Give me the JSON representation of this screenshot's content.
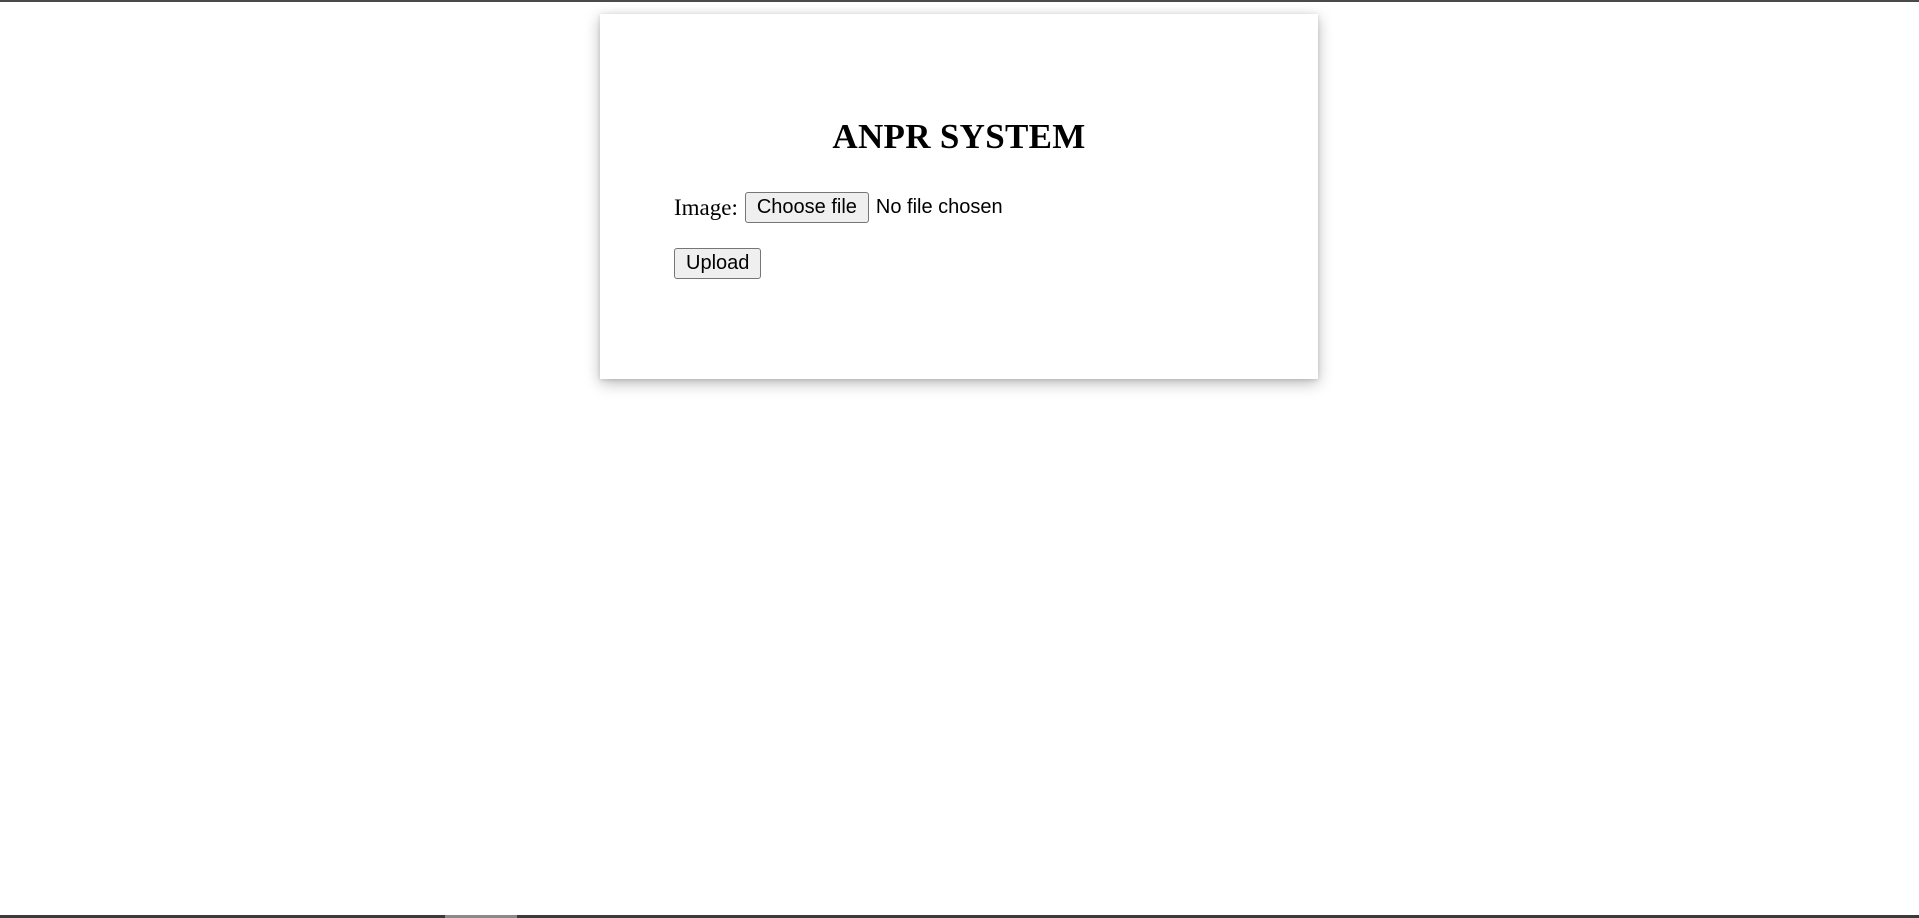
{
  "form": {
    "title": "ANPR SYSTEM",
    "image_label": "Image:",
    "file_button_label": "Choose file",
    "file_status": "No file chosen",
    "upload_button_label": "Upload"
  }
}
